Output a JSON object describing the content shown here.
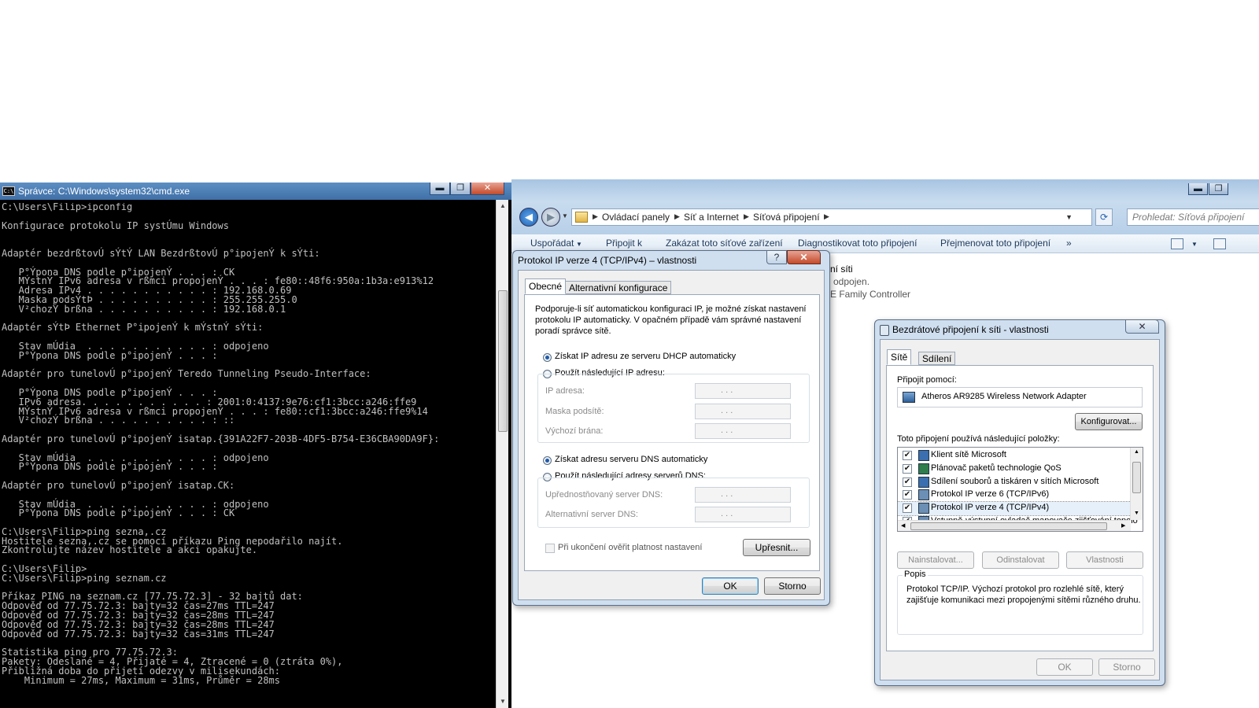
{
  "cmd": {
    "icon_text": "C:\\",
    "title": "Správce: C:\\Windows\\system32\\cmd.exe",
    "min": "▬",
    "max": "❐",
    "close": "✕",
    "lines": [
      "C:\\Users\\Filip>ipconfig",
      "",
      "Konfigurace protokolu IP systÚmu Windows",
      "",
      "",
      "Adaptér bezdrßtovÚ sÝtÝ LAN BezdrßtovÚ p°ipojenÝ k sÝti:",
      "",
      "   P°Ýpona DNS podle p°ipojenÝ . . . : CK",
      "   MÝstnÝ IPv6 adresa v rßmci propojenÝ . . . : fe80::48f6:950a:1b3a:e913%12",
      "   Adresa IPv4 . . . . . . . . . . . : 192.168.0.69",
      "   Maska podsÝtÞ . . . . . . . . . . : 255.255.255.0",
      "   V²chozÝ brßna . . . . . . . . . . : 192.168.0.1",
      "",
      "Adaptér sÝtÞ Ethernet P°ipojenÝ k mÝstnÝ sÝti:",
      "",
      "   Stav mÚdia  . . . . . . . . . . . : odpojeno",
      "   P°Ýpona DNS podle p°ipojenÝ . . . :",
      "",
      "Adaptér pro tunelovÚ p°ipojenÝ Teredo Tunneling Pseudo-Interface:",
      "",
      "   P°Ýpona DNS podle p°ipojenÝ . . . :",
      "   IPv6 adresa. . . . . . . . . . . : 2001:0:4137:9e76:cf1:3bcc:a246:ffe9",
      "   MÝstnÝ IPv6 adresa v rßmci propojenÝ . . . : fe80::cf1:3bcc:a246:ffe9%14",
      "   V²chozÝ brßna . . . . . . . . . . : ::",
      "",
      "Adaptér pro tunelovÚ p°ipojenÝ isatap.{391A22F7-203B-4DF5-B754-E36CBA90DA9F}:",
      "",
      "   Stav mÚdia  . . . . . . . . . . . : odpojeno",
      "   P°Ýpona DNS podle p°ipojenÝ . . . :",
      "",
      "Adaptér pro tunelovÚ p°ipojenÝ isatap.CK:",
      "",
      "   Stav mÚdia  . . . . . . . . . . . : odpojeno",
      "   P°Ýpona DNS podle p°ipojenÝ . . . : CK",
      "",
      "C:\\Users\\Filip>ping sezna,.cz",
      "Hostitele sezna,.cz se pomocí příkazu Ping nepodařilo najít.",
      "Zkontrolujte název hostitele a akci opakujte.",
      "",
      "C:\\Users\\Filip>",
      "C:\\Users\\Filip>ping seznam.cz",
      "",
      "Příkaz PING na seznam.cz [77.75.72.3] - 32 bajtů dat:",
      "Odpověď od 77.75.72.3: bajty=32 čas=27ms TTL=247",
      "Odpověď od 77.75.72.3: bajty=32 čas=28ms TTL=247",
      "Odpověď od 77.75.72.3: bajty=32 čas=28ms TTL=247",
      "Odpověď od 77.75.72.3: bajty=32 čas=31ms TTL=247",
      "",
      "Statistika ping pro 77.75.72.3:",
      "Pakety: Odeslané = 4, Přijaté = 4, Ztracené = 0 (ztráta 0%),",
      "Přibližná doba do přijetí odezvy v milisekundách:",
      "    Minimum = 27ms, Maximum = 31ms, Průměr = 28ms"
    ]
  },
  "explorer": {
    "breadcrumbs": [
      "Ovládací panely",
      "Síť a Internet",
      "Síťová připojení"
    ],
    "search_placeholder": "Prohledat: Síťová připojení",
    "commands": [
      "Uspořádat",
      "Připojit k",
      "Zakázat toto síťové zařízení",
      "Diagnostikovat toto připojení",
      "Přejmenovat toto připojení",
      "»"
    ],
    "bg_lines": [
      "ní síti",
      "odpojen.",
      "E Family Controller"
    ],
    "min": "▬",
    "max": "❐"
  },
  "ipv4_dialog": {
    "title": "Protokol IP verze 4 (TCP/IPv4) – vlastnosti",
    "help": "?",
    "close": "✕",
    "tabs": [
      "Obecné",
      "Alternativní konfigurace"
    ],
    "intro": [
      "Podporuje-li síť automatickou konfiguraci IP, je možné získat nastavení",
      "protokolu IP automaticky. V opačném případě vám správné nastavení",
      "poradí správce sítě."
    ],
    "radio_auto_ip": "Získat IP adresu ze serveru DHCP automaticky",
    "radio_manual_ip": "Použít následující IP adresu:",
    "ip_address_label": "IP adresa:",
    "subnet_label": "Maska podsítě:",
    "gateway_label": "Výchozí brána:",
    "ip_placeholder_dots": ". . .",
    "radio_auto_dns": "Získat adresu serveru DNS automaticky",
    "radio_manual_dns": "Použít následující adresy serverů DNS:",
    "pref_dns_label": "Upřednostňovaný server DNS:",
    "alt_dns_label": "Alternativní server DNS:",
    "validate_label": "Při ukončení ověřit platnost nastavení",
    "advanced_button": "Upřesnit...",
    "ok_button": "OK",
    "cancel_button": "Storno"
  },
  "wifi_dialog": {
    "title": "Bezdrátové připojení k síti - vlastnosti",
    "close": "✕",
    "tabs": [
      "Sítě",
      "Sdílení"
    ],
    "connect_using_label": "Připojit pomocí:",
    "adapter_name": "Atheros AR9285 Wireless Network Adapter",
    "configure_button": "Konfigurovat...",
    "items_label": "Toto připojení používá následující položky:",
    "items": [
      {
        "label": "Klient sítě Microsoft",
        "checked": true,
        "icon": "network-client-icon"
      },
      {
        "label": "Plánovač paketů technologie QoS",
        "checked": true,
        "icon": "qos-scheduler-icon"
      },
      {
        "label": "Sdílení souborů a tiskáren v sítích Microsoft",
        "checked": true,
        "icon": "file-sharing-icon"
      },
      {
        "label": "Protokol IP verze 6 (TCP/IPv6)",
        "checked": true,
        "icon": "protocol-icon"
      },
      {
        "label": "Protokol IP verze 4 (TCP/IPv4)",
        "checked": true,
        "icon": "protocol-icon"
      },
      {
        "label": "Vstupně-výstupní ovladač mapovače zjišťování topolo",
        "checked": true,
        "icon": "protocol-icon"
      }
    ],
    "install_button": "Nainstalovat...",
    "uninstall_button": "Odinstalovat",
    "properties_button": "Vlastnosti",
    "description_title": "Popis",
    "description_text": [
      "Protokol TCP/IP. Výchozí protokol pro rozlehlé sítě, který",
      "zajišťuje komunikaci mezi propojenými sítěmi různého druhu."
    ],
    "ok_button": "OK",
    "cancel_button": "Storno"
  }
}
